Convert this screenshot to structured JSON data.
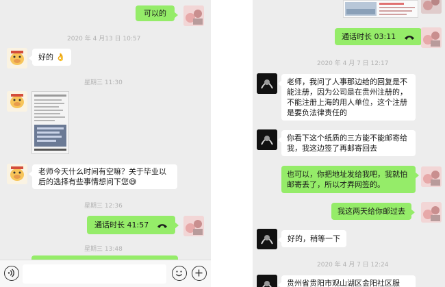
{
  "left": {
    "messages": {
      "ok_reply": "可以的",
      "good": "好的",
      "question": "老师今天什么时间有空嘛？关于毕业以后的选择有些事情想问下您",
      "call_duration": "通话时长 41:57"
    },
    "timestamps": {
      "t1": "2020 年 4 月13 日 10:57",
      "t2": "星期三 11:30",
      "t3": "星期三 12:36",
      "t4": "星期三 13:48"
    },
    "emoji": {
      "ok_hand": "👌",
      "sweat": "😅"
    }
  },
  "right": {
    "messages": {
      "call_duration": "通话时长 03:11",
      "m1": "老师，我问了人事那边给的回复是不能注册，因为公司是在贵州注册的，不能注册上海的用人单位，这个注册是要负法律责任的",
      "m2": "你看下这个纸质的三方能不能邮寄给我，我这边签了再邮寄回去",
      "m3": "也可以，你把地址发给我吧，我就怕邮寄丢了，所以才弄网签的。",
      "m4": "我这两天给你邮过去",
      "m5": "好的，稍等一下",
      "m6": "贵州省贵阳市观山湖区金阳社区服"
    },
    "timestamps": {
      "t1": "2020 年 4 月 7 日 12:17",
      "t2": "2020 年 4 月 7 日 12:24"
    }
  },
  "colors": {
    "chat_bg": "#ededed",
    "self_bubble": "#95ec69",
    "other_bubble": "#ffffff",
    "timestamp": "#b2b2b2"
  },
  "icons": [
    "pig-avatar",
    "dark-avatar",
    "photo-avatar",
    "phone-call-icon",
    "voice-icon",
    "emoji-icon",
    "plus-icon"
  ]
}
